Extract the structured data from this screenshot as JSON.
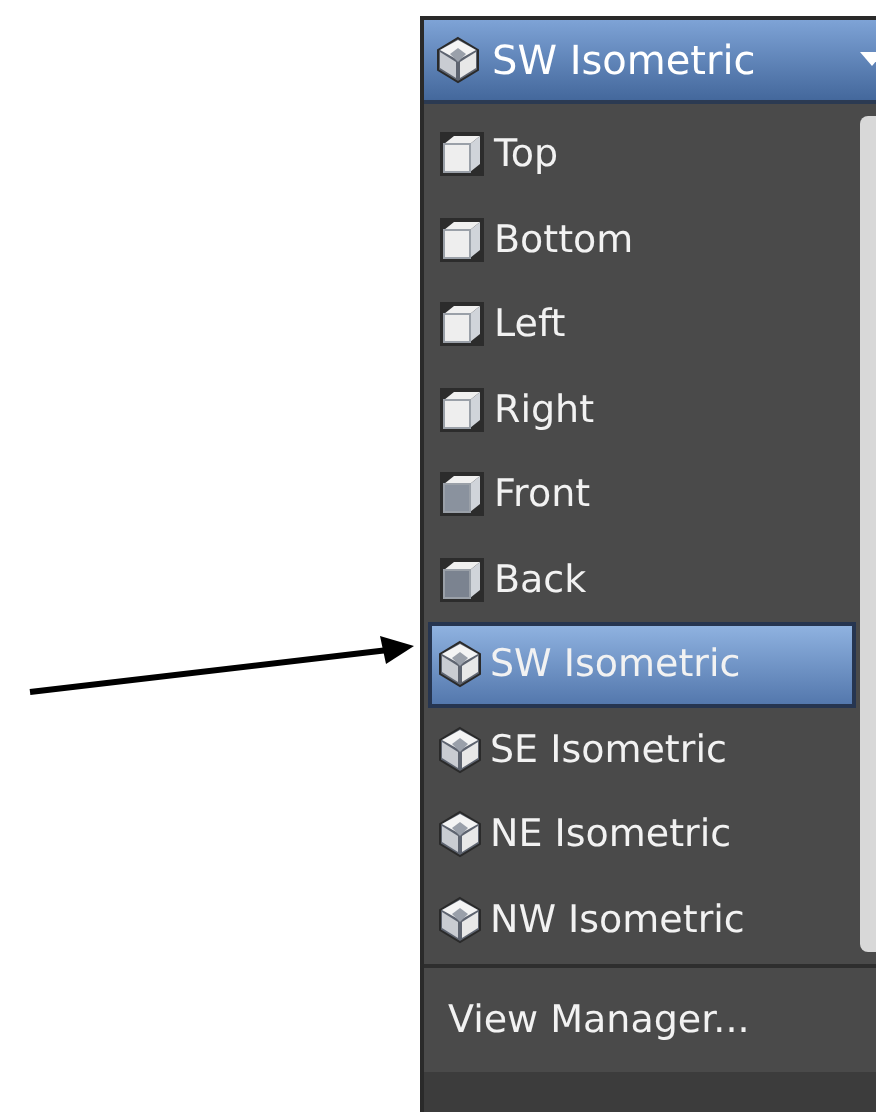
{
  "dropdown": {
    "label": "SW Isometric"
  },
  "views": [
    {
      "label": "Top",
      "kind": "ortho",
      "selected": false
    },
    {
      "label": "Bottom",
      "kind": "ortho",
      "selected": false
    },
    {
      "label": "Left",
      "kind": "ortho",
      "selected": false
    },
    {
      "label": "Right",
      "kind": "ortho",
      "selected": false
    },
    {
      "label": "Front",
      "kind": "ortho",
      "selected": false
    },
    {
      "label": "Back",
      "kind": "ortho",
      "selected": false
    },
    {
      "label": "SW Isometric",
      "kind": "iso",
      "selected": true
    },
    {
      "label": "SE Isometric",
      "kind": "iso",
      "selected": false
    },
    {
      "label": "NE Isometric",
      "kind": "iso",
      "selected": false
    },
    {
      "label": "NW Isometric",
      "kind": "iso",
      "selected": false
    }
  ],
  "footer_item": {
    "label": "View Manager..."
  }
}
